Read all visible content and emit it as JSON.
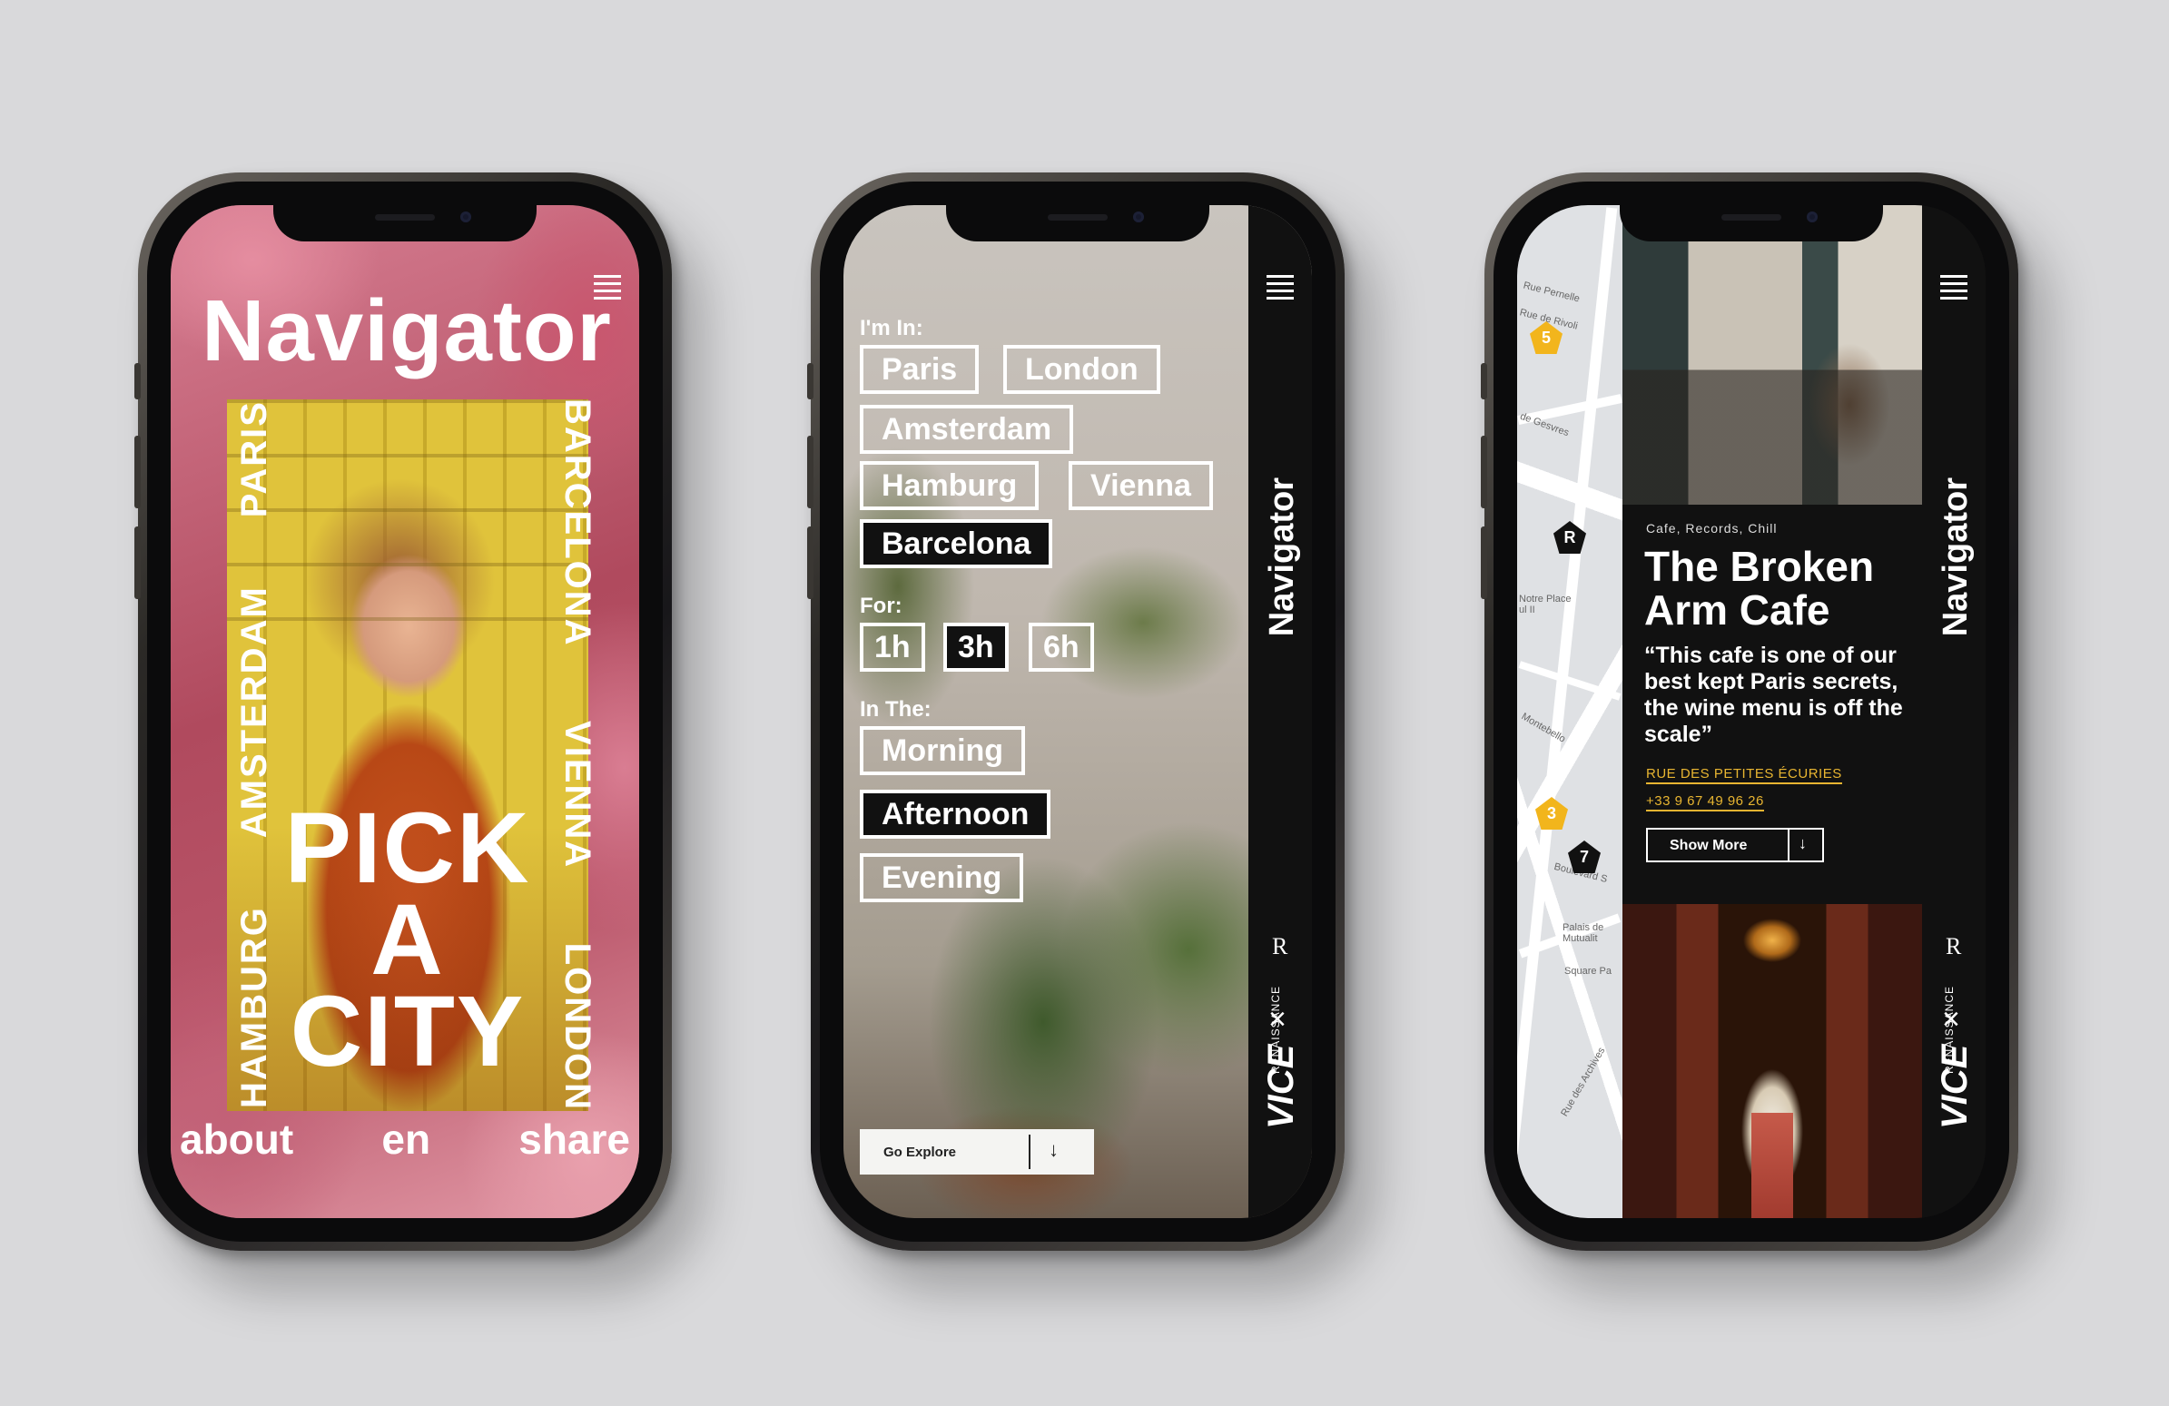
{
  "phone1": {
    "title": "Navigator",
    "cities_left": [
      "HAMBURG",
      "AMSTERDAM",
      "PARIS"
    ],
    "cities_right": [
      "BARCELONA",
      "VIENNA",
      "LONDON"
    ],
    "headline": [
      "PICK",
      "A",
      "CITY"
    ],
    "footer": {
      "about": "about",
      "language": "en",
      "share": "share"
    }
  },
  "phone2": {
    "im_in_label": "I'm In:",
    "cities": [
      "Paris",
      "London",
      "Amsterdam",
      "Hamburg",
      "Vienna",
      "Barcelona"
    ],
    "selected_city": "Barcelona",
    "for_label": "For:",
    "durations": [
      "1h",
      "3h",
      "6h"
    ],
    "selected_duration": "3h",
    "in_the_label": "In The:",
    "times": [
      "Morning",
      "Afternoon",
      "Evening"
    ],
    "selected_time": "Afternoon",
    "explore_label": "Go Explore",
    "explore_arrow": "↓",
    "side_title": "Navigator",
    "brand_renaissance": "RENAISSANCE",
    "brand_r": "R",
    "brand_x": "×",
    "brand_vice": "VICE"
  },
  "phone3": {
    "tags": "Cafe, Records, Chill",
    "name": "The Broken Arm Cafe",
    "quote": "“This cafe is one of our best kept Paris secrets, the wine menu is off the scale”",
    "street": "RUE DES PETITES ÉCURIES",
    "phone": "+33 9 67 49 96 26",
    "show_more": "Show More",
    "show_more_arrow": "↓",
    "side_title": "Navigator",
    "map_pins": [
      "5",
      "3",
      "7"
    ],
    "map_pin_logo": "R",
    "map_labels": [
      "Rue de Rivoli",
      "de Gesvres",
      "Notre Place ul II",
      "Montebello",
      "Boulevard S",
      "Palais de Mutualit",
      "Square Pa",
      "Rue des Archives",
      "Rue Pernelle"
    ]
  },
  "colors": {
    "accent_gold": "#e8b531",
    "panel_black": "#111111",
    "pin_yellow": "#f2b51c"
  }
}
